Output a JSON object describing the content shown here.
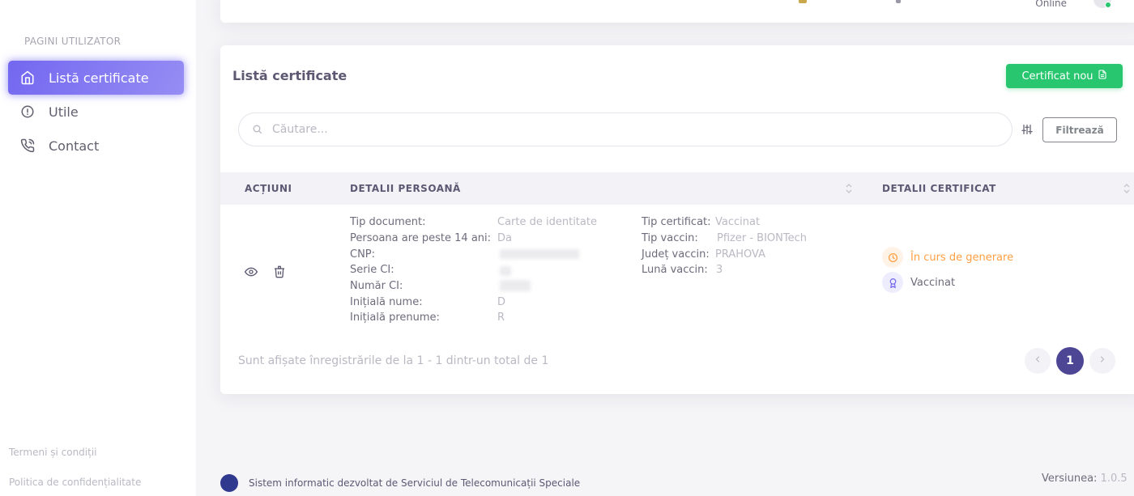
{
  "sidebar": {
    "section_title": "PAGINI UTILIZATOR",
    "items": [
      {
        "label": "Listă certificate",
        "icon": "home-icon",
        "active": true
      },
      {
        "label": "Utile",
        "icon": "info-icon",
        "active": false
      },
      {
        "label": "Contact",
        "icon": "phone-icon",
        "active": false
      }
    ],
    "footer_links": [
      "Termeni și condiții",
      "Politica de confidențialitate"
    ]
  },
  "topbar": {
    "status": "Online"
  },
  "card": {
    "title": "Listă certificate",
    "new_button": "Certificat nou",
    "search_placeholder": "Căutare...",
    "filter_button": "Filtrează",
    "columns": [
      "ACȚIUNI",
      "DETALII PERSOANĂ",
      "DETALII CERTIFICAT"
    ],
    "row": {
      "person": [
        {
          "label": "Tip document:",
          "value": "Carte de identitate"
        },
        {
          "label": "Persoana are peste 14 ani:",
          "value": "Da"
        },
        {
          "label": "CNP:",
          "value": ""
        },
        {
          "label": "Serie CI:",
          "value": ""
        },
        {
          "label": "Număr CI:",
          "value": ""
        },
        {
          "label": "Inițială nume:",
          "value": "D"
        },
        {
          "label": "Inițială prenume:",
          "value": "R"
        }
      ],
      "certificate": [
        {
          "label": "Tip certificat:",
          "value": "Vaccinat"
        },
        {
          "label": "Tip vaccin:",
          "value": "Pfizer - BIONTech"
        },
        {
          "label": "Județ vaccin:",
          "value": "PRAHOVA"
        },
        {
          "label": "Lună vaccin:",
          "value": "3"
        }
      ],
      "statuses": [
        {
          "label": "În curs de generare",
          "icon": "clock-icon",
          "color": "#ff9f43"
        },
        {
          "label": "Vaccinat",
          "icon": "award-icon",
          "color": "#7367f0"
        }
      ]
    },
    "showing_text": "Sunt afișate înregistrările de la 1 - 1 dintr-un total de 1",
    "pagination": {
      "current": "1"
    }
  },
  "footer": {
    "text": "Sistem informatic dezvoltat de Serviciul de Telecomunicații Speciale",
    "version_label": "Versiunea:",
    "version_value": "1.0.5"
  },
  "colors": {
    "accent": "#7367f0",
    "success": "#28c76f",
    "warning": "#ff9f43",
    "page_active": "#4c4695"
  }
}
